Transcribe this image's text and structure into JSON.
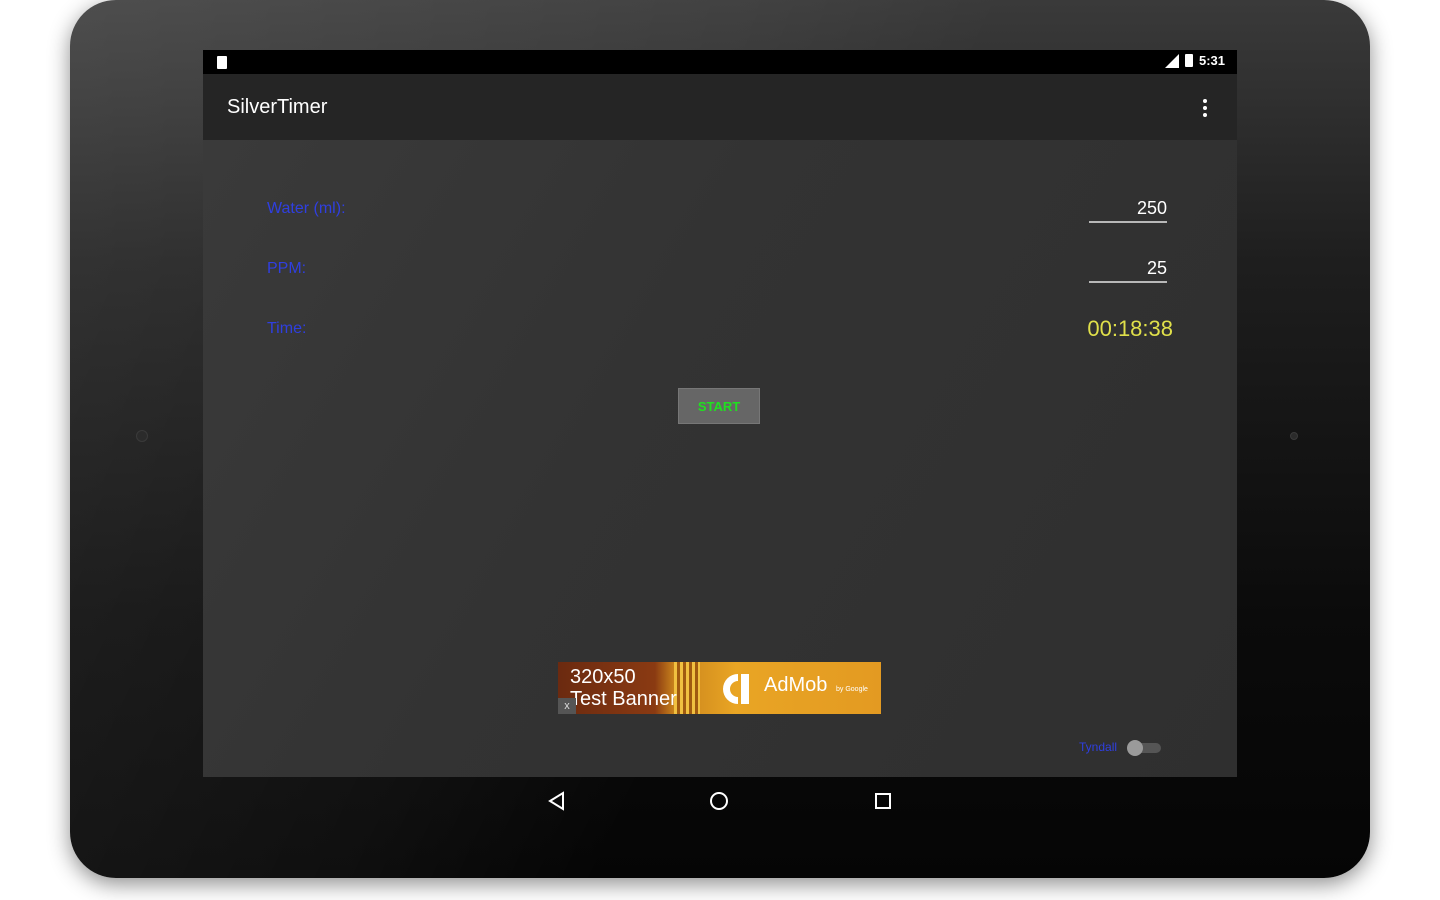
{
  "status_bar": {
    "time": "5:31"
  },
  "app": {
    "title": "SilverTimer"
  },
  "form": {
    "water_label": "Water (ml):",
    "water_value": "250",
    "ppm_label": "PPM:",
    "ppm_value": "25",
    "time_label": "Time:",
    "time_value": "00:18:38"
  },
  "start_button": {
    "label": "START"
  },
  "ad": {
    "line1": "320x50",
    "line2": "Test Banner",
    "close": "x",
    "brand": "AdMob",
    "brand_sub": "by Google"
  },
  "toggle": {
    "label": "Tyndall",
    "checked": false
  },
  "colors": {
    "label_blue": "#2f3fe0",
    "time_yellow": "#e0e04a",
    "start_green": "#20e020",
    "screen_bg": "#2f2f2f"
  },
  "icons": {
    "nav_back": "back-triangle-icon",
    "nav_home": "home-circle-icon",
    "nav_recents": "recents-square-icon"
  }
}
